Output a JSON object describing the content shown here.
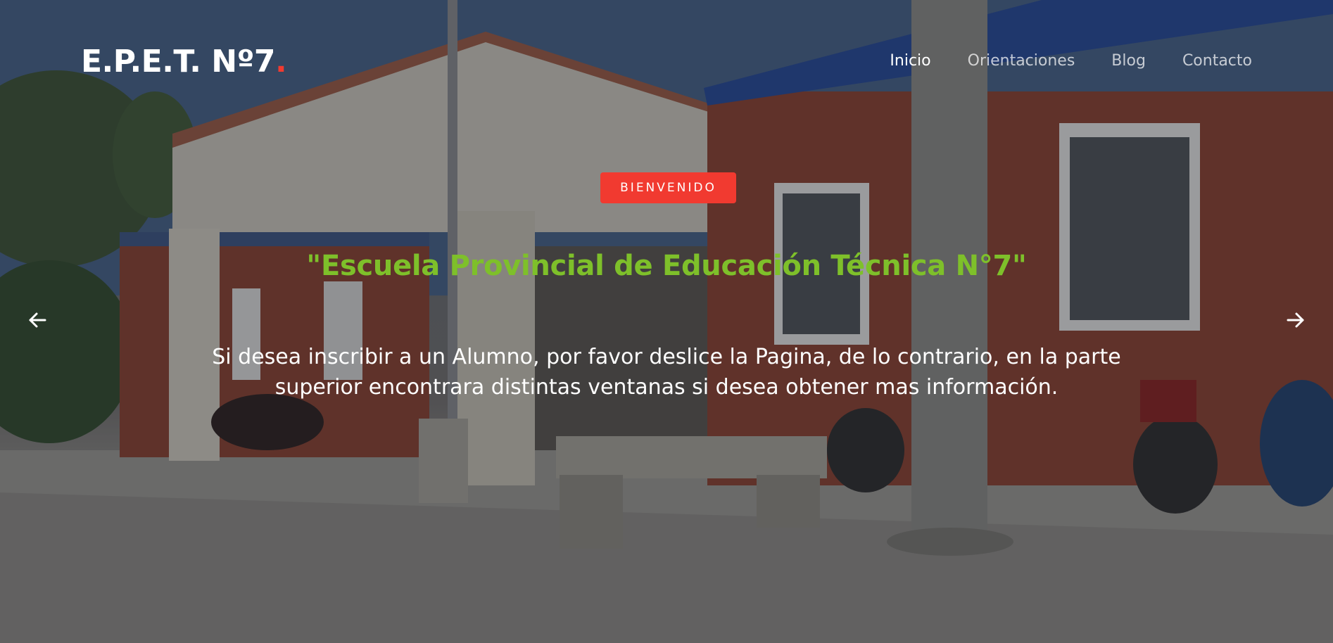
{
  "navbar": {
    "brand": "E.P.E.T. Nº7",
    "brand_dot": ".",
    "menu": [
      {
        "label": "Inicio",
        "active": true
      },
      {
        "label": "Orientaciones",
        "active": false
      },
      {
        "label": "Blog",
        "active": false
      },
      {
        "label": "Contacto",
        "active": false
      }
    ]
  },
  "hero": {
    "badge": "BIENVENIDO",
    "title": "\"Escuela Provincial de Educación Técnica N°7\"",
    "text": "Si desea inscribir a un Alumno, por favor deslice la Pagina, de lo contrario, en la parte superior encontrara distintas ventanas si desea obtener mas información.",
    "prev_icon": "arrow-left-icon",
    "next_icon": "arrow-right-icon"
  },
  "colors": {
    "accent": "#f13a30",
    "title_green": "#7ec02a",
    "text": "#ffffff"
  }
}
